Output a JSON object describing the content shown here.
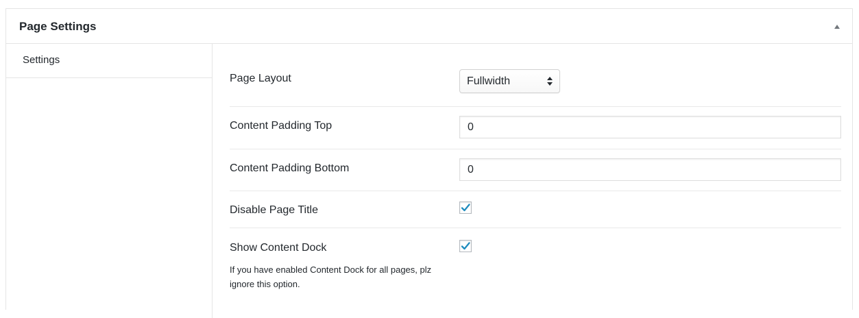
{
  "metabox": {
    "title": "Page Settings"
  },
  "tabs": [
    {
      "label": "Settings"
    }
  ],
  "fields": {
    "page_layout": {
      "label": "Page Layout",
      "value": "Fullwidth"
    },
    "padding_top": {
      "label": "Content Padding Top",
      "value": "0"
    },
    "padding_bottom": {
      "label": "Content Padding Bottom",
      "value": "0"
    },
    "disable_title": {
      "label": "Disable Page Title",
      "checked": true
    },
    "content_dock": {
      "label": "Show Content Dock",
      "checked": true,
      "description": "If you have enabled Content Dock for all pages, plz ignore this option."
    }
  },
  "colors": {
    "checkmark": "#1e8cbe",
    "border": "#e5e5e5",
    "text": "#23282d"
  },
  "icons": {
    "toggle": "triangle-up-icon",
    "checkbox": "checkmark-icon",
    "select": "updown-arrows-icon"
  }
}
